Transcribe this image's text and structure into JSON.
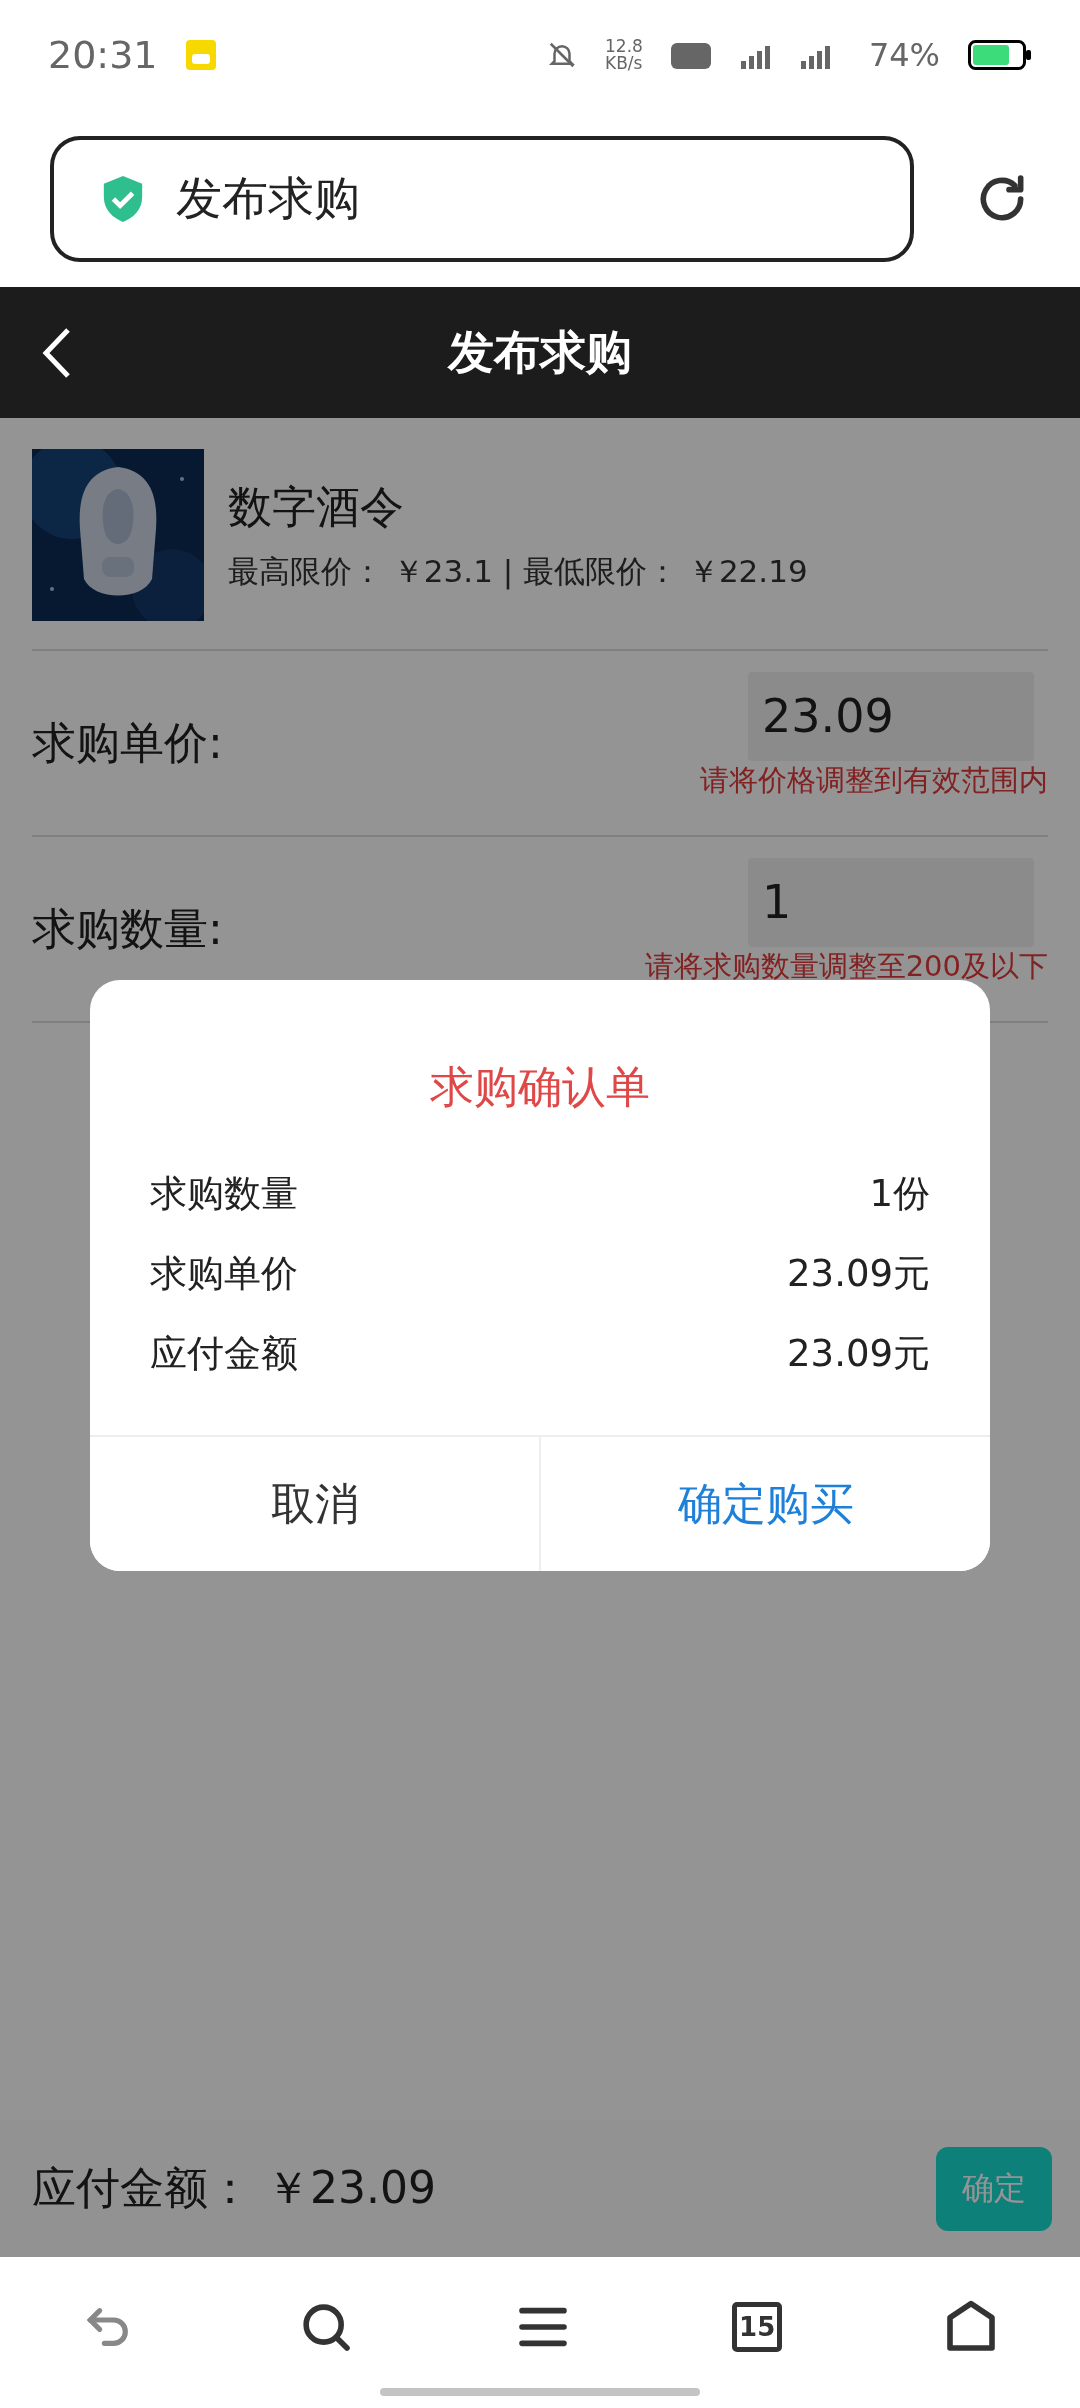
{
  "status_bar": {
    "time": "20:31",
    "net_speed": "12.8",
    "net_unit": "KB/s",
    "battery": "74%"
  },
  "browser": {
    "address": "发布求购"
  },
  "header": {
    "title": "发布求购"
  },
  "product": {
    "name": "数字酒令",
    "limits": "最高限价： ￥23.1 | 最低限价： ￥22.19"
  },
  "form": [
    {
      "label": "求购单价:",
      "value": "23.09",
      "error": "请将价格调整到有效范围内"
    },
    {
      "label": "求购数量:",
      "value": "1",
      "error": "请将求购数量调整至200及以下"
    }
  ],
  "total_bar": {
    "label": "应付金额： ￥23.09",
    "button": "确定"
  },
  "dialog": {
    "title": "求购确认单",
    "rows": [
      {
        "label": "求购数量",
        "value": "1份"
      },
      {
        "label": "求购单价",
        "value": "23.09元"
      },
      {
        "label": "应付金额",
        "value": "23.09元"
      }
    ],
    "buttons": [
      {
        "label": "取消",
        "kind": "cancel"
      },
      {
        "label": "确定购买",
        "kind": "confirm"
      }
    ]
  },
  "nav": {
    "tabs_count": "15"
  }
}
